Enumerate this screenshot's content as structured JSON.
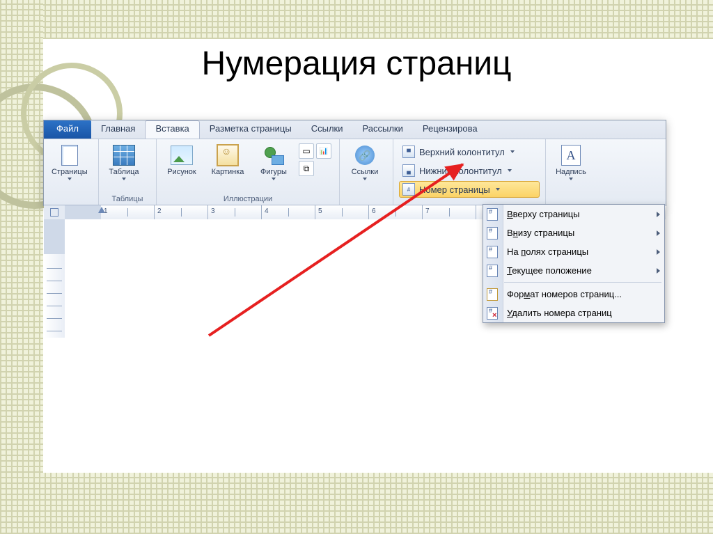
{
  "title": "Нумерация страниц",
  "tabs": {
    "file": "Файл",
    "home": "Главная",
    "insert": "Вставка",
    "layout": "Разметка страницы",
    "references": "Ссылки",
    "mailings": "Рассылки",
    "review": "Рецензирова"
  },
  "groups": {
    "pages": {
      "label": "Страницы"
    },
    "tables": {
      "label": "Таблицы",
      "button": "Таблица"
    },
    "illustrations": {
      "label": "Иллюстрации",
      "picture": "Рисунок",
      "clipart": "Картинка",
      "shapes": "Фигуры"
    },
    "links": {
      "label": "Ссылки",
      "button": "Ссылки"
    },
    "header_footer": {
      "header": "Верхний колонтитул",
      "footer": "Нижний колонтитул",
      "pagenum": "Номер страницы"
    },
    "text": {
      "textbox": "Надпись"
    }
  },
  "menu": {
    "top": "Вверху страницы",
    "bottom": "Внизу страницы",
    "margins": "На полях страницы",
    "current": "Текущее положение",
    "format": "Формат номеров страниц...",
    "remove": "Удалить номера страниц"
  },
  "ruler": {
    "nums": [
      "1",
      "2",
      "3",
      "4",
      "5",
      "6",
      "7"
    ]
  }
}
